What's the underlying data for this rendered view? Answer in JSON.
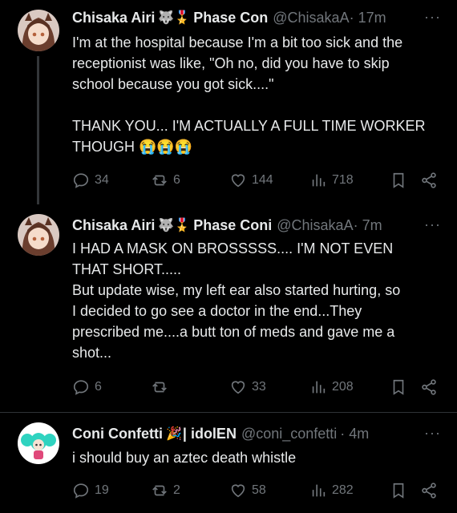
{
  "tweets": [
    {
      "name": "Chisaka Airi",
      "name_emojis": "🐺🎖️",
      "name_suffix": "Phase Con",
      "handle": "@ChisakaA",
      "time": "· 17m",
      "more": "···",
      "lines": [
        "I'm at the hospital because I'm a bit too sick and the",
        "receptionist was like, \"Oh no, did you have to skip",
        "school because you got sick....\"",
        "",
        "THANK YOU... I'M ACTUALLY A FULL TIME WORKER",
        "THOUGH 😭😭😭"
      ],
      "replies": "34",
      "reposts": "6",
      "likes": "144",
      "views": "718"
    },
    {
      "name": "Chisaka Airi",
      "name_emojis": "🐺🎖️",
      "name_suffix": "Phase Coni",
      "handle": "@ChisakaA",
      "time": "· 7m",
      "more": "···",
      "lines": [
        "I HAD A MASK ON BROSSSSS.... I'M NOT EVEN",
        "THAT SHORT.....",
        "But update wise, my left ear also started hurting, so",
        "I decided to go see a doctor in the end...They",
        "prescribed me....a butt ton of meds and gave me a",
        "shot..."
      ],
      "replies": "6",
      "reposts": "",
      "likes": "33",
      "views": "208"
    },
    {
      "name": "Coni Confetti",
      "name_emojis": "🎉",
      "name_suffix": "| idolEN",
      "handle": "@coni_confetti",
      "time": "· 4m",
      "more": "···",
      "lines": [
        "i should buy an aztec death whistle"
      ],
      "replies": "19",
      "reposts": "2",
      "likes": "58",
      "views": "282"
    }
  ],
  "colors": {
    "background": "#000000",
    "text": "#e7e9ea",
    "muted": "#71767b",
    "divider": "#2f3336"
  }
}
